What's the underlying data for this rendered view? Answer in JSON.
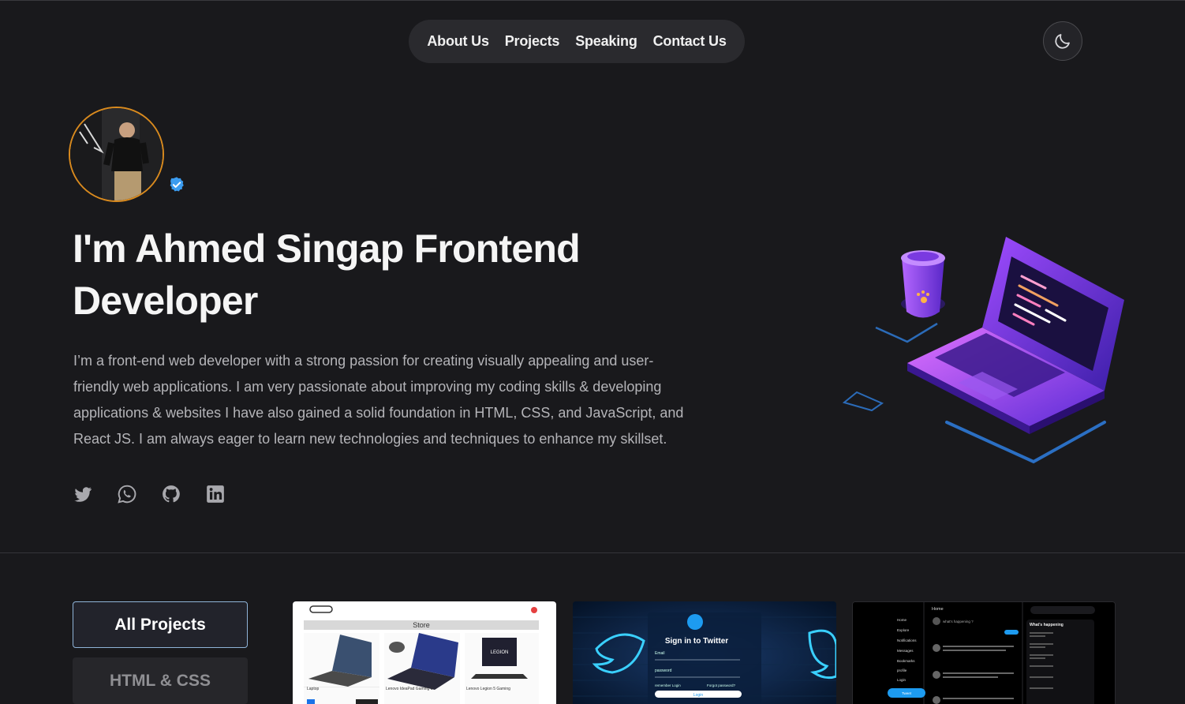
{
  "nav": {
    "items": [
      "About Us",
      "Projects",
      "Speaking",
      "Contact Us"
    ]
  },
  "theme_toggle": {
    "icon": "moon-icon"
  },
  "hero": {
    "title": "I'm Ahmed Singap Frontend Developer",
    "description": "I’m a front-end web developer with a strong passion for creating visually appealing and user-friendly web applications. I am very passionate about improving my coding skills & developing applications & websites I have also gained a solid foundation in HTML, CSS, and JavaScript, and React JS. I am always eager to learn new technologies and techniques to enhance my skillset.",
    "verified_icon": "verified-badge-icon",
    "socials": [
      "twitter-icon",
      "whatsapp-icon",
      "github-icon",
      "linkedin-icon"
    ]
  },
  "projects": {
    "filters": [
      "All Projects",
      "HTML & CSS"
    ],
    "active_filter": "All Projects",
    "cards": [
      {
        "header": "Store",
        "items": [
          "Laptop",
          "Lenovo IdeaPad Gaming 3",
          "Lenovo Legion 5 Gaming"
        ],
        "badge": "LEGION"
      },
      {
        "title": "Sign in to Twitter",
        "fields": [
          "Email",
          "password"
        ],
        "remember": "remember Login",
        "forgot": "Forgot password?",
        "button": "Login"
      },
      {
        "header": "Home",
        "sidebar": [
          "Home",
          "Explore",
          "Notifications",
          "Messages",
          "Bookmarks",
          "profile",
          "Login"
        ],
        "trend_title": "What's happening",
        "composer": "what's happening ?",
        "tweet_button": "Tweet"
      }
    ]
  },
  "colors": {
    "background": "#19191c",
    "nav_pill": "#2a2a2e",
    "accent_blue": "#8fb4d8",
    "avatar_ring": "#d98a1e",
    "verified_blue": "#3b9cf0"
  }
}
